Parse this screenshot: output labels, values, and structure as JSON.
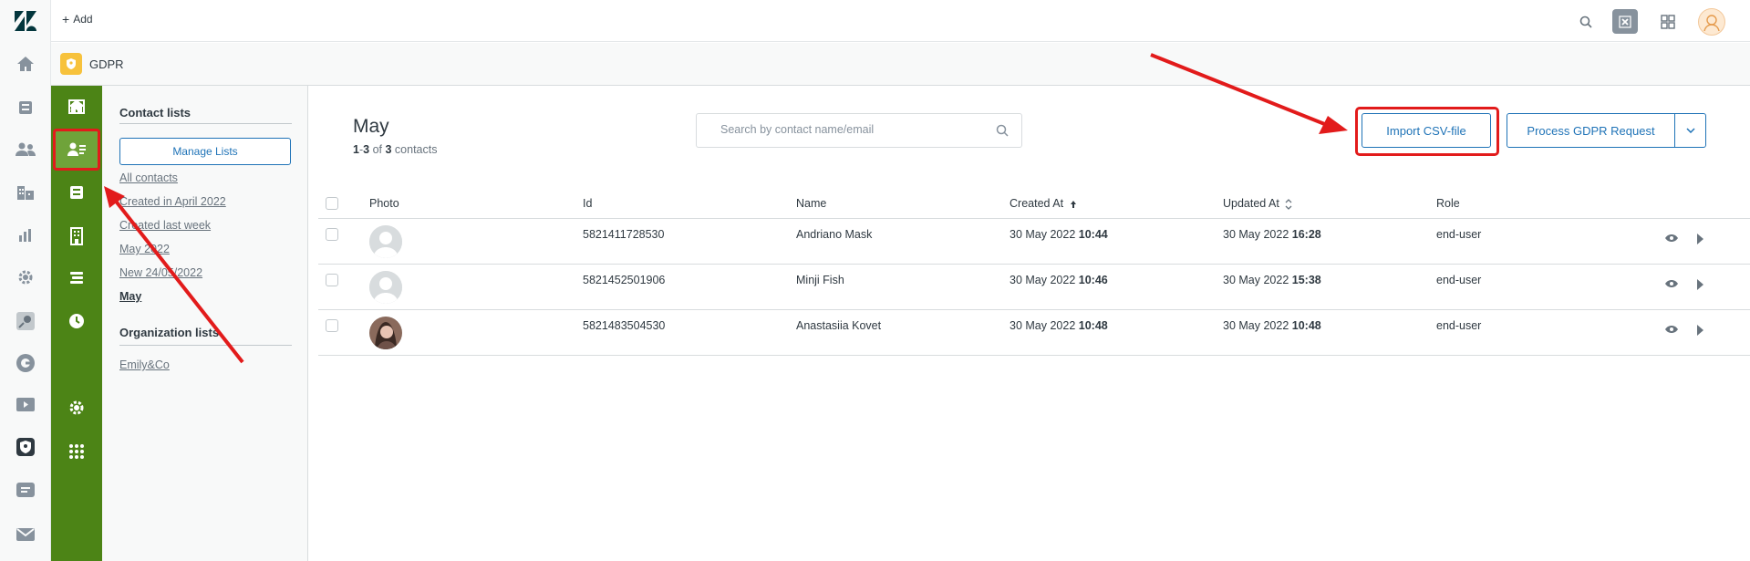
{
  "topbar": {
    "add_label": "Add",
    "add_plus": "+"
  },
  "app": {
    "title": "GDPR"
  },
  "lists_panel": {
    "contact_heading": "Contact lists",
    "manage_label": "Manage Lists",
    "contact_lists": [
      "All contacts",
      "Created in April 2022",
      "Created last week",
      "May 2022",
      "New 24/05/2022",
      "May"
    ],
    "current_list": "May",
    "org_heading": "Organization lists",
    "org_lists": [
      "Emily&Co"
    ]
  },
  "main": {
    "title": "May",
    "count": {
      "from": "1",
      "to": "3",
      "of": "of",
      "total": "3",
      "unit": "contacts"
    },
    "search_placeholder": "Search by contact name/email",
    "import_label": "Import CSV-file",
    "process_label": "Process GDPR Request"
  },
  "table": {
    "headers": {
      "photo": "Photo",
      "id": "Id",
      "name": "Name",
      "created": "Created At",
      "updated": "Updated At",
      "role": "Role"
    },
    "rows": [
      {
        "id": "5821411728530",
        "name": "Andriano Mask",
        "created_date": "30 May 2022",
        "created_time": "10:44",
        "updated_date": "30 May 2022",
        "updated_time": "16:28",
        "role": "end-user",
        "photo": "default-avatar"
      },
      {
        "id": "5821452501906",
        "name": "Minji Fish",
        "created_date": "30 May 2022",
        "created_time": "10:46",
        "updated_date": "30 May 2022",
        "updated_time": "15:38",
        "role": "end-user",
        "photo": "default-avatar"
      },
      {
        "id": "5821483504530",
        "name": "Anastasiia Kovet",
        "created_date": "30 May 2022",
        "created_time": "10:48",
        "updated_date": "30 May 2022",
        "updated_time": "10:48",
        "role": "end-user",
        "photo": "user-photo"
      }
    ]
  },
  "colors": {
    "brand_green": "#4c8416",
    "active_green": "#6fa33a",
    "accent_blue": "#1f73b7",
    "annotation_red": "#e21b1b",
    "app_badge_yellow": "#f7c23c"
  },
  "icons": {
    "rail": [
      "zendesk-logo",
      "home-icon",
      "views-icon",
      "customers-icon",
      "organizations-icon",
      "reporting-icon",
      "admin-gear-icon",
      "app-icon",
      "app-icon",
      "app-icon",
      "gdpr-app-icon",
      "app-icon",
      "app-icon"
    ],
    "appnav": [
      "home-icon",
      "contacts-icon",
      "inbox-icon",
      "organizations-icon",
      "stack-icon",
      "clock-icon",
      "chart-icon",
      "gear-icon",
      "apps-grid-icon"
    ]
  }
}
